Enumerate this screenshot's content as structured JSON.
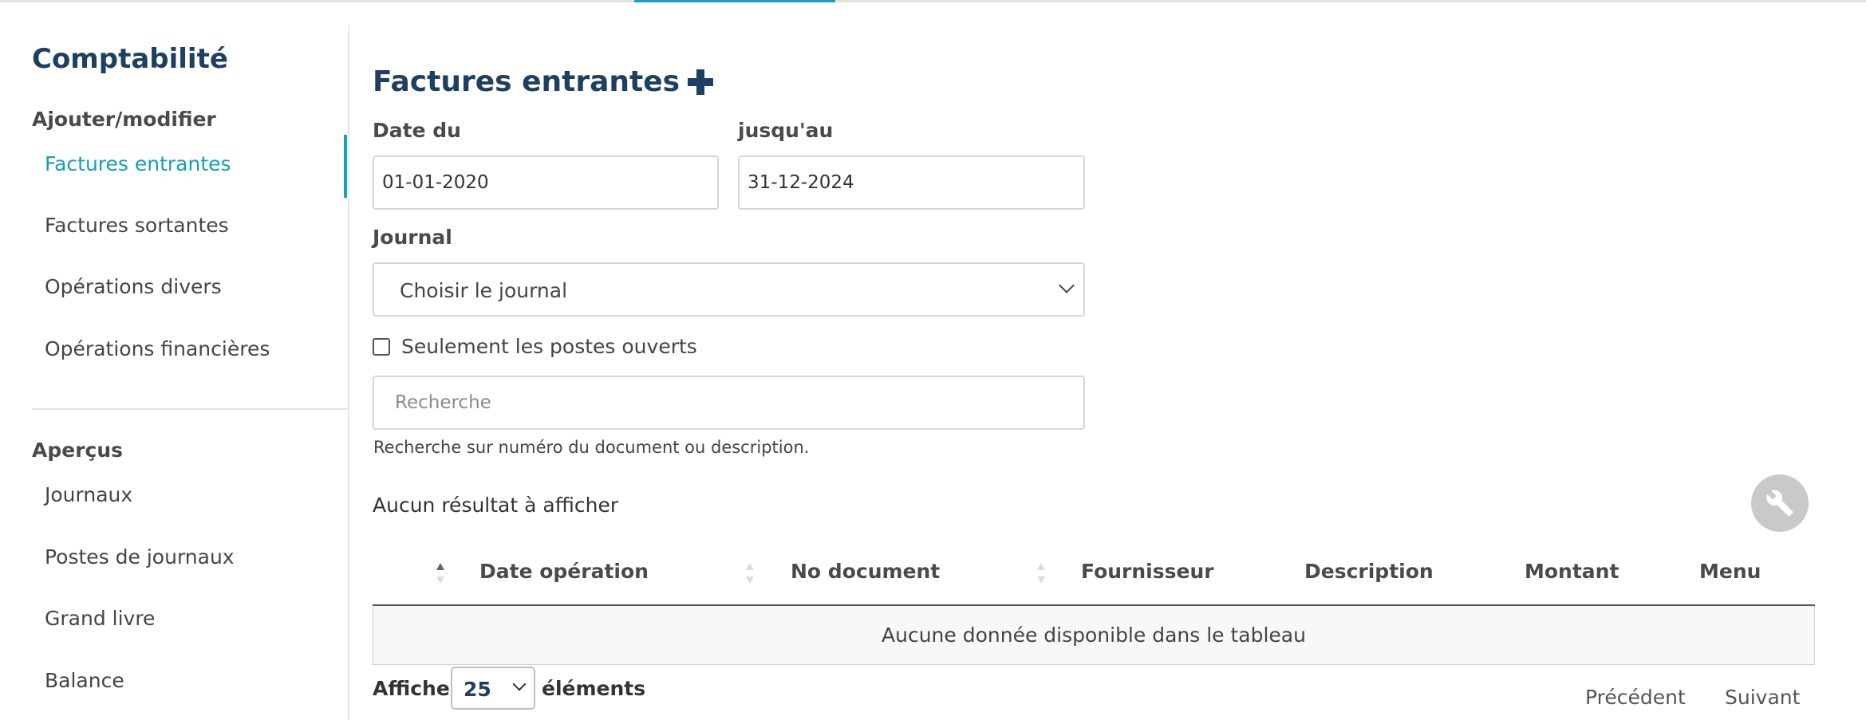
{
  "sidebar": {
    "title": "Comptabilité",
    "section_edit": "Ajouter/modifier",
    "edit_items": [
      {
        "label": "Factures entrantes"
      },
      {
        "label": "Factures sortantes"
      },
      {
        "label": "Opérations divers"
      },
      {
        "label": "Opérations financières"
      }
    ],
    "section_overview": "Aperçus",
    "overview_items": [
      {
        "label": "Journaux"
      },
      {
        "label": "Postes de journaux"
      },
      {
        "label": "Grand livre"
      },
      {
        "label": "Balance"
      }
    ]
  },
  "main": {
    "title": "Factures entrantes",
    "date_from_label": "Date du",
    "date_from_value": "01-01-2020",
    "date_to_label": "jusqu'au",
    "date_to_value": "31-12-2024",
    "journal_label": "Journal",
    "journal_selected": "Choisir le journal",
    "open_items_label": "Seulement les postes ouverts",
    "search_placeholder": "Recherche",
    "search_hint": "Recherche sur numéro du document ou description.",
    "no_result": "Aucun résultat à afficher"
  },
  "table": {
    "columns": [
      "Date opération",
      "No document",
      "Fournisseur",
      "Description",
      "Montant",
      "Menu"
    ],
    "empty_text": "Aucune donnée disponible dans le tableau"
  },
  "pagination": {
    "show_label": "Afficher",
    "page_size": "25",
    "elements_label": "éléments",
    "previous": "Précédent",
    "next": "Suivant"
  },
  "colors": {
    "accent": "#1aa1b6",
    "heading": "#1e3f60"
  },
  "icons": {
    "add": "plus-icon",
    "settings": "wrench-icon",
    "dropdown": "chevron-down-icon",
    "sort": "sort-icon"
  }
}
